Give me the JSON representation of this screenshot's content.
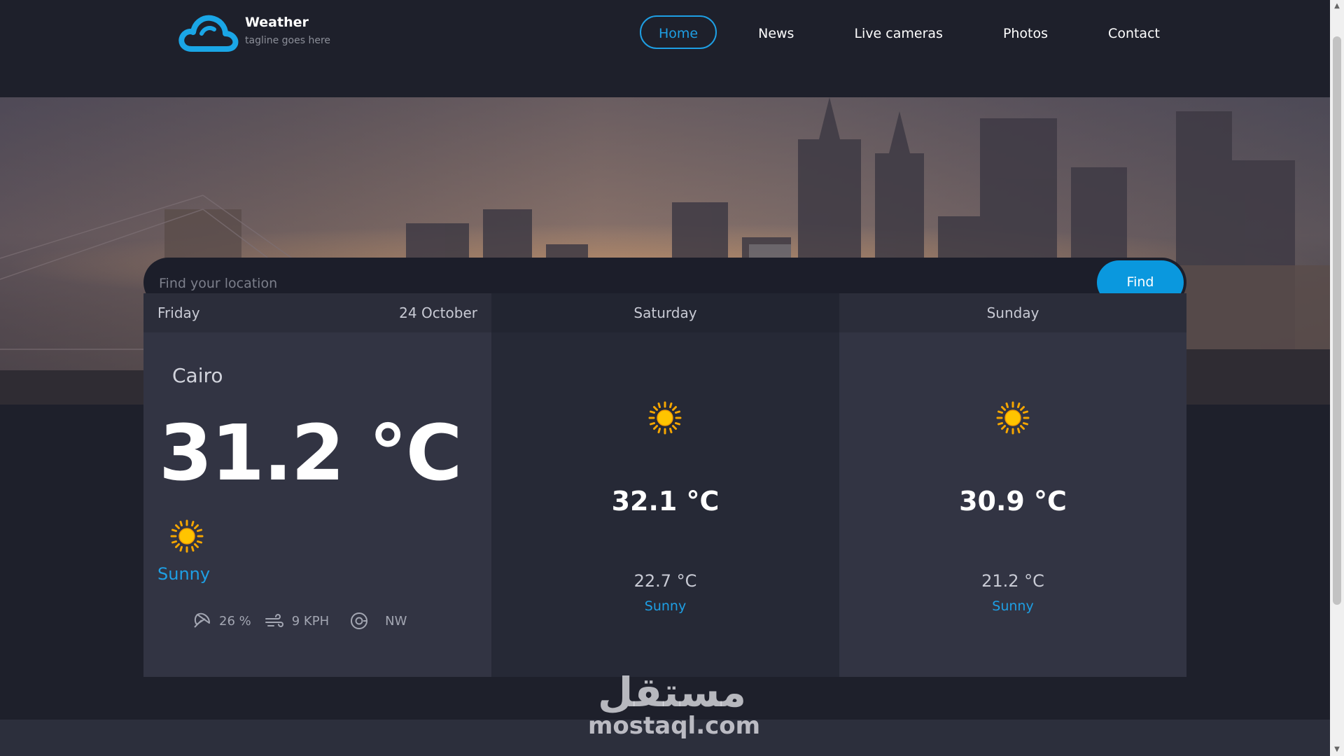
{
  "brand": {
    "name": "Weather",
    "tagline": "tagline goes here",
    "icon": "cloud-icon"
  },
  "nav": {
    "items": [
      {
        "label": "Home",
        "active": true
      },
      {
        "label": "News"
      },
      {
        "label": "Live cameras"
      },
      {
        "label": "Photos"
      },
      {
        "label": "Contact"
      }
    ]
  },
  "search": {
    "placeholder": "Find your location",
    "button_label": "Find"
  },
  "today": {
    "day": "Friday",
    "date": "24 October",
    "city": "Cairo",
    "temp": "31.2 °C",
    "condition": "Sunny",
    "humidity": "26 %",
    "wind_speed": "9 KPH",
    "wind_dir": "NW"
  },
  "tomorrow": {
    "day": "Saturday",
    "max": "32.1 °C",
    "min": "22.7 °C",
    "condition": "Sunny"
  },
  "after": {
    "day": "Sunday",
    "max": "30.9 °C",
    "min": "21.2 °C",
    "condition": "Sunny"
  },
  "watermark": {
    "arabic": "مستقل",
    "latin": "mostaql.com"
  },
  "colors": {
    "accent": "#1e9fe4",
    "background": "#1e202b",
    "card": "#323443",
    "card_alt": "#262936"
  }
}
